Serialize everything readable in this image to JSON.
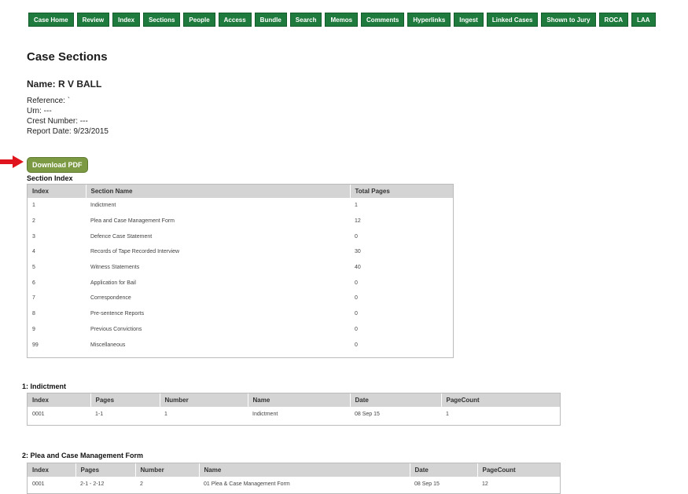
{
  "nav": [
    "Case Home",
    "Review",
    "Index",
    "Sections",
    "People",
    "Access",
    "Bundle",
    "Search",
    "Memos",
    "Comments",
    "Hyperlinks",
    "Ingest",
    "Linked Cases",
    "Shown to Jury",
    "ROCA",
    "LAA"
  ],
  "page_title": "Case Sections",
  "case": {
    "name": "Name: R V BALL",
    "reference": "Reference: `",
    "urn": "Urn: ---",
    "crest": "Crest Number: ---",
    "report_date": "Report Date: 9/23/2015"
  },
  "download_pdf": "Download PDF",
  "section_index": {
    "heading": "Section Index",
    "headers": [
      "Index",
      "Section Name",
      "Total Pages"
    ],
    "rows": [
      [
        "1",
        "Indictment",
        "1"
      ],
      [
        "2",
        "Plea and Case Management Form",
        "12"
      ],
      [
        "3",
        "Defence Case Statement",
        "0"
      ],
      [
        "4",
        "Records of Tape Recorded Interview",
        "30"
      ],
      [
        "5",
        "Witness Statements",
        "40"
      ],
      [
        "6",
        "Application for Bail",
        "0"
      ],
      [
        "7",
        "Correspondence",
        "0"
      ],
      [
        "8",
        "Pre-sentence Reports",
        "0"
      ],
      [
        "9",
        "Previous Convictions",
        "0"
      ],
      [
        "99",
        "Miscellaneous",
        "0"
      ]
    ]
  },
  "indictment": {
    "heading": "1: Indictment",
    "headers": [
      "Index",
      "Pages",
      "Number",
      "Name",
      "Date",
      "PageCount"
    ],
    "rows": [
      [
        "0001",
        "1-1",
        "1",
        "Indictment",
        "08 Sep 15",
        "1"
      ]
    ]
  },
  "plea": {
    "heading": "2: Plea and Case Management Form",
    "headers": [
      "Index",
      "Pages",
      "Number",
      "Name",
      "Date",
      "PageCount"
    ],
    "rows": [
      [
        "0001",
        "2-1 - 2-12",
        "2",
        "01 Plea & Case Management Form",
        "08 Sep 15",
        "12"
      ]
    ]
  },
  "colors": {
    "nav_bg": "#1f7a3d",
    "pdf_bg": "#7c9a43",
    "arrow": "#e0141c",
    "header_bg": "#d4d4d4"
  }
}
